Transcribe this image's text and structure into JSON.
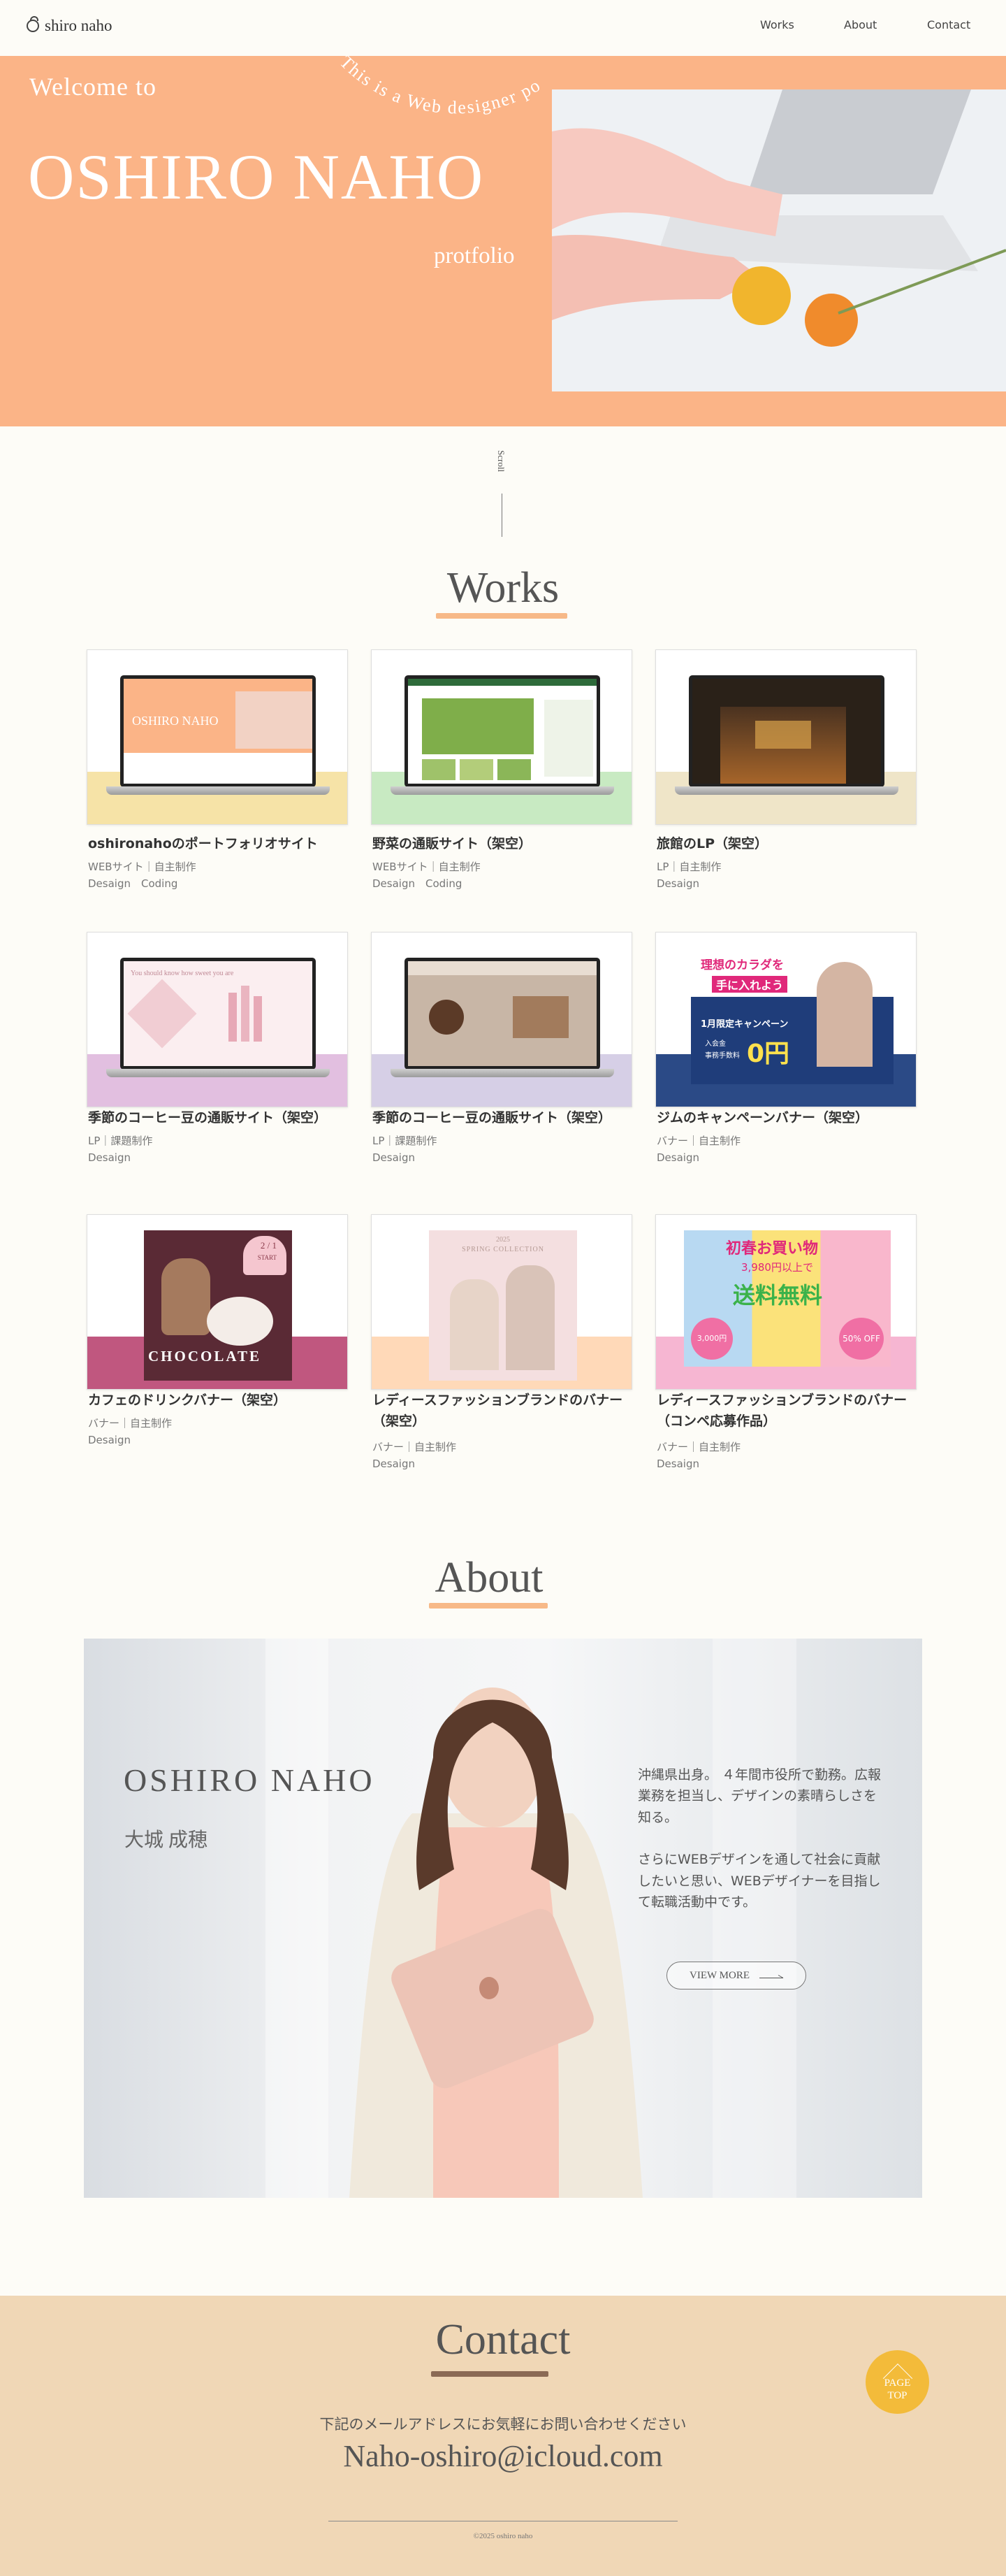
{
  "header": {
    "logo": "shiro naho",
    "nav": [
      "Works",
      "About",
      "Contact"
    ]
  },
  "hero": {
    "arc_text": "This is a Web designer portfolio",
    "welcome": "Welcome to",
    "name": "OSHIRO NAHO",
    "portfolio": "protfolio"
  },
  "scroll": {
    "label": "Scroll"
  },
  "works": {
    "title": "Works",
    "items": [
      {
        "title": "oshironahoのポートフォリオサイト",
        "meta": "WEBサイト｜自主制作",
        "tags": "Desaign　Coding",
        "band": "#f6e3a7"
      },
      {
        "title": "野菜の通販サイト（架空）",
        "meta": "WEBサイト｜自主制作",
        "tags": "Desaign　Coding",
        "band": "#c8eac2"
      },
      {
        "title": "旅館のLP（架空）",
        "meta": "LP｜自主制作",
        "tags": "Desaign",
        "band": "#efe5c8"
      },
      {
        "title": "季節のコーヒー豆の通販サイト（架空）",
        "meta": "LP｜課題制作",
        "tags": "Desaign",
        "band": "#e2bfe0"
      },
      {
        "title": "季節のコーヒー豆の通販サイト（架空）",
        "meta": "LP｜課題制作",
        "tags": "Desaign",
        "band": "#d6cfe6"
      },
      {
        "title": "ジムのキャンペーンバナー（架空）",
        "meta": "バナー｜自主制作",
        "tags": "Desaign",
        "band": "#2b4a86"
      },
      {
        "title": "カフェのドリンクバナー（架空）",
        "meta": "バナー｜自主制作",
        "tags": "Desaign",
        "band": "#c0577f"
      },
      {
        "title": "レディースファッションブランドのバナー（架空）",
        "meta": "バナー｜自主制作",
        "tags": "Desaign",
        "band": "#ffd9b8"
      },
      {
        "title": "レディースファッションブランドのバナー（コンペ応募作品）",
        "meta": "バナー｜自主制作",
        "tags": "Desaign",
        "band": "#f6b6d2"
      }
    ]
  },
  "thumbs": {
    "portfolio": "OSHIRO NAHO",
    "coffee_text": "You should know how sweet you are",
    "gym_1": "理想のカラダを",
    "gym_2": "手に入れよう",
    "gym_3": "1月限定キャンペーン",
    "gym_4": "入会金",
    "gym_5": "事務手数料",
    "gym_6": "0円",
    "choco_date": "2 / 1",
    "choco_start": "START",
    "choco": "CHOCOLATE",
    "spring_year": "2025",
    "spring": "SPRING COLLECTION",
    "sale_1": "初春お買い物",
    "sale_2": "3,980円以上で",
    "sale_3": "送料無料",
    "sale_4": "3,000円",
    "sale_5": "50% OFF"
  },
  "about": {
    "title": "About",
    "name": "OSHIRO NAHO",
    "kanji": "大城 成穂",
    "p1": "沖縄県出身。 ４年間市役所で勤務。広報業務を担当し、デザインの素晴らしさを知る。",
    "p2": "さらにWEBデザインを通して社会に貢献したいと思い、WEBデザイナーを目指して転職活動中です。",
    "button": "VIEW MORE"
  },
  "contact": {
    "title": "Contact",
    "lead": "下記のメールアドレスにお気軽にお問い合わせください",
    "email": "Naho-oshiro@icloud.com",
    "copyright": "©2025 oshiro naho",
    "pagetop_1": "PAGE",
    "pagetop_2": "TOP"
  }
}
